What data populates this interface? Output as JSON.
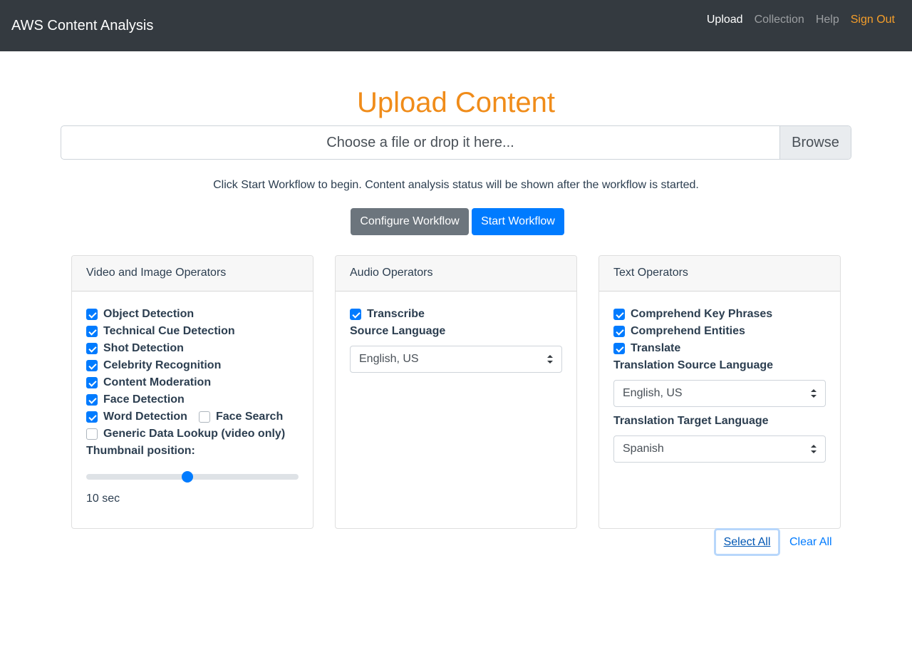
{
  "navbar": {
    "brand": "AWS Content Analysis",
    "links": [
      {
        "label": "Upload",
        "active": true
      },
      {
        "label": "Collection",
        "active": false
      },
      {
        "label": "Help",
        "active": false
      },
      {
        "label": "Sign Out",
        "active": false
      }
    ]
  },
  "page": {
    "title": "Upload Content",
    "file_input": {
      "placeholder": "Choose a file or drop it here...",
      "browse_label": "Browse"
    },
    "instructions": "Click Start Workflow to begin. Content analysis status will be shown after the workflow is started.",
    "configure_label": "Configure Workflow",
    "start_label": "Start Workflow"
  },
  "video_card": {
    "header": "Video and Image Operators",
    "operators": [
      {
        "label": "Object Detection",
        "checked": true
      },
      {
        "label": "Technical Cue Detection",
        "checked": true
      },
      {
        "label": "Shot Detection",
        "checked": true
      },
      {
        "label": "Celebrity Recognition",
        "checked": true
      },
      {
        "label": "Content Moderation",
        "checked": true
      },
      {
        "label": "Face Detection",
        "checked": true
      },
      {
        "label": "Word Detection",
        "checked": true
      },
      {
        "label": "Face Search",
        "checked": false
      },
      {
        "label": "Generic Data Lookup (video only)",
        "checked": false
      }
    ],
    "thumbnail_label": "Thumbnail position:",
    "thumbnail_fraction": 0.475,
    "thumbnail_value": "10 sec"
  },
  "audio_card": {
    "header": "Audio Operators",
    "transcribe": {
      "label": "Transcribe",
      "checked": true
    },
    "source_language_label": "Source Language",
    "source_language": "English, US"
  },
  "text_card": {
    "header": "Text Operators",
    "operators": [
      {
        "label": "Comprehend Key Phrases",
        "checked": true
      },
      {
        "label": "Comprehend Entities",
        "checked": true
      },
      {
        "label": "Translate",
        "checked": true
      }
    ],
    "source_label": "Translation Source Language",
    "source_language": "English, US",
    "target_label": "Translation Target Language",
    "target_language": "Spanish"
  },
  "actions": {
    "select_all": "Select All",
    "clear_all": "Clear All"
  },
  "colors": {
    "navbar_bg": "#343a40",
    "accent_orange": "#f08c1a",
    "primary_blue": "#007bff",
    "secondary_gray": "#6c757d"
  }
}
